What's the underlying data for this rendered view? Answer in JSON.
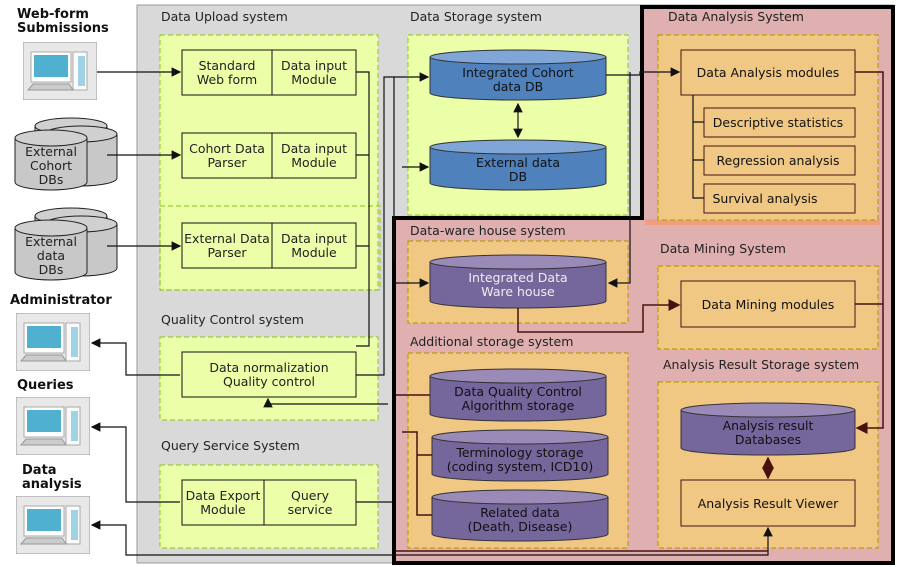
{
  "actors": {
    "webform": [
      "Web-form",
      "Submissions"
    ],
    "cohort_dbs": [
      "External",
      "Cohort",
      "DBs"
    ],
    "ext_dbs": [
      "External",
      "data",
      "DBs"
    ],
    "administrator": "Administrator",
    "queries": "Queries",
    "data_analysis": [
      "Data",
      "analysis"
    ]
  },
  "systems": {
    "upload": {
      "title": "Data Upload system",
      "web_form": [
        "Standard",
        "Web form"
      ],
      "cohort_parser": [
        "Cohort Data",
        "Parser"
      ],
      "ext_parser": [
        "External Data",
        "Parser"
      ],
      "input_module": [
        "Data input",
        "Module"
      ]
    },
    "storage": {
      "title": "Data Storage system",
      "cohort_db": [
        "Integrated Cohort",
        "data DB"
      ],
      "external_db": [
        "External data",
        "DB"
      ]
    },
    "analysis": {
      "title": "Data Analysis System",
      "modules": "Data Analysis modules",
      "items": [
        "Descriptive statistics",
        "Regression analysis",
        "Survival analysis"
      ]
    },
    "warehouse": {
      "title": "Data-ware house system",
      "db": [
        "Integrated Data",
        "Ware house"
      ]
    },
    "mining": {
      "title": "Data Mining System",
      "modules": "Data Mining modules"
    },
    "quality": {
      "title": "Quality Control system",
      "box": [
        "Data normalization",
        "Quality control"
      ]
    },
    "additional": {
      "title": "Additional storage system",
      "dq": [
        "Data Quality  Control",
        "Algorithm storage"
      ],
      "term": [
        "Terminology storage",
        "(coding system, ICD10)"
      ],
      "related": [
        "Related data",
        "(Death, Disease)"
      ]
    },
    "result": {
      "title": "Analysis Result Storage system",
      "db": [
        "Analysis result",
        "Databases"
      ],
      "viewer": "Analysis Result Viewer"
    },
    "query": {
      "title": "Query Service System",
      "export": [
        "Data Export",
        "Module"
      ],
      "service": [
        "Query",
        "service"
      ]
    }
  },
  "colors": {
    "gray_panel": "#d9d9d9",
    "yellow_green": "#eaffa8",
    "pink": "#e0b0b0",
    "orange": "#f0c884",
    "blue_db": "#4f81bd",
    "purple_db": "#75669c"
  }
}
